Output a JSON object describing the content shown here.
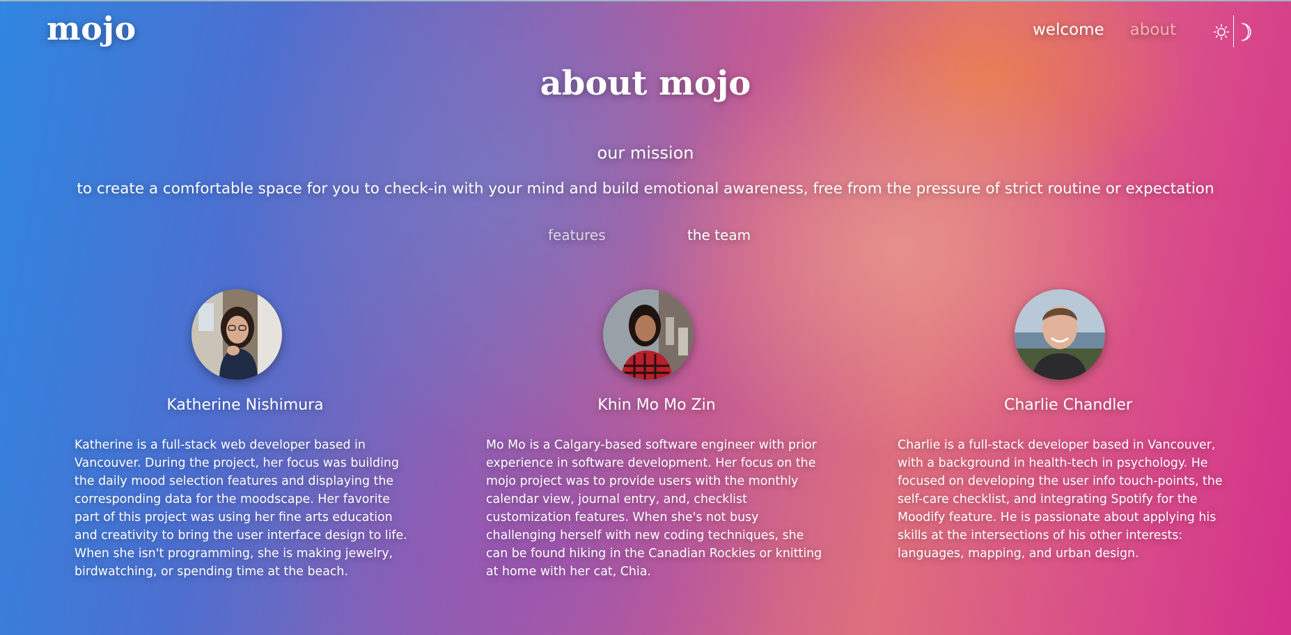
{
  "header": {
    "logo": "mojo",
    "nav": [
      {
        "label": "welcome",
        "active": false
      },
      {
        "label": "about",
        "active": true
      }
    ],
    "theme_toggle": {
      "icons": [
        "sun-icon",
        "moon-icon"
      ]
    }
  },
  "main": {
    "title": "about mojo",
    "mission_heading": "our mission",
    "mission_text": "to create a comfortable space for you to check-in with your mind and build emotional awareness, free from the pressure of strict routine or expectation",
    "tabs": [
      {
        "label": "features",
        "active": false
      },
      {
        "label": "the team",
        "active": true
      }
    ],
    "team": [
      {
        "name": "Katherine Nishimura",
        "bio": "Katherine is a full-stack web developer based in Vancouver. During the project, her focus was building the daily mood selection features and displaying the corresponding data for the moodscape. Her favorite part of this project was using her fine arts education and creativity to bring the user interface design to life. When she isn't programming, she is making jewelry, birdwatching, or spending time at the beach."
      },
      {
        "name": "Khin Mo Mo Zin",
        "bio": "Mo Mo is a Calgary-based software engineer with prior experience in software development. Her focus on the mojo project was to provide users with the monthly calendar view, journal entry, and, checklist customization features. When she's not busy challenging herself with new coding techniques, she can be found hiking in the Canadian Rockies or knitting at home with her cat, Chia."
      },
      {
        "name": "Charlie Chandler",
        "bio": "Charlie is a full-stack developer based in Vancouver, with a background in health-tech in psychology. He focused on developing the user info touch-points, the self-care checklist, and integrating Spotify for the Moodify feature. He is passionate about applying his skills at the intersections of his other interests: languages, mapping, and urban design."
      }
    ]
  }
}
